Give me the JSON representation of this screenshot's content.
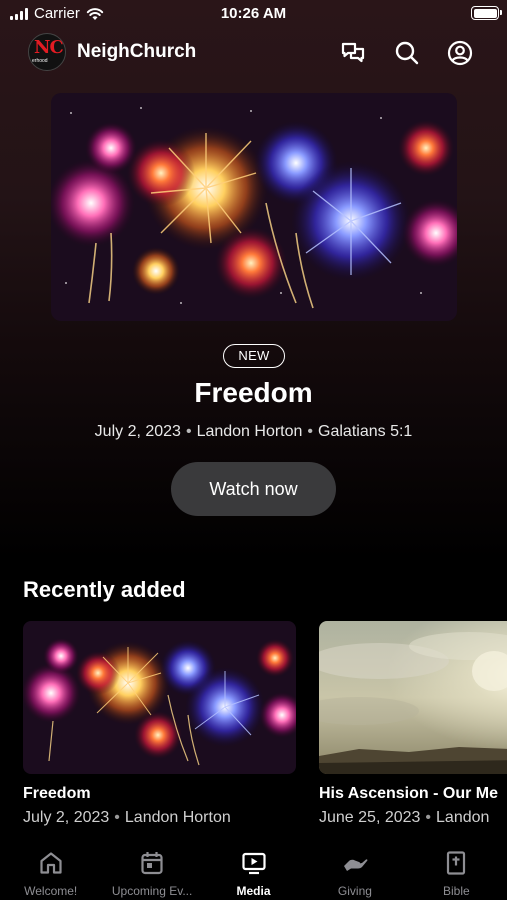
{
  "status_bar": {
    "carrier": "Carrier",
    "time": "10:26 AM",
    "battery_level": 1.0
  },
  "app": {
    "title": "NeighChurch",
    "logo_text": "NC",
    "logo_subtext": "erhood"
  },
  "header_icons": [
    "chat-icon",
    "search-icon",
    "account-icon"
  ],
  "hero": {
    "badge": "NEW",
    "title": "Freedom",
    "date": "July 2, 2023",
    "speaker": "Landon Horton",
    "scripture": "Galatians 5:1",
    "button_label": "Watch now",
    "separator": "•"
  },
  "recently_added": {
    "title": "Recently added",
    "items": [
      {
        "title": "Freedom",
        "date": "July 2, 2023",
        "speaker": "Landon Horton"
      },
      {
        "title": "His Ascension - Our Me",
        "date": "June 25, 2023",
        "speaker": "Landon"
      }
    ]
  },
  "tabs": [
    {
      "label": "Welcome!",
      "icon": "home-icon",
      "active": false
    },
    {
      "label": "Upcoming Ev...",
      "icon": "calendar-icon",
      "active": false
    },
    {
      "label": "Media",
      "icon": "media-icon",
      "active": true
    },
    {
      "label": "Giving",
      "icon": "giving-icon",
      "active": false
    },
    {
      "label": "Bible",
      "icon": "bible-icon",
      "active": false
    }
  ],
  "colors": {
    "accent_red": "#e21c23",
    "button_bg": "#3a3a3c",
    "inactive_tab": "#8e8e93"
  }
}
